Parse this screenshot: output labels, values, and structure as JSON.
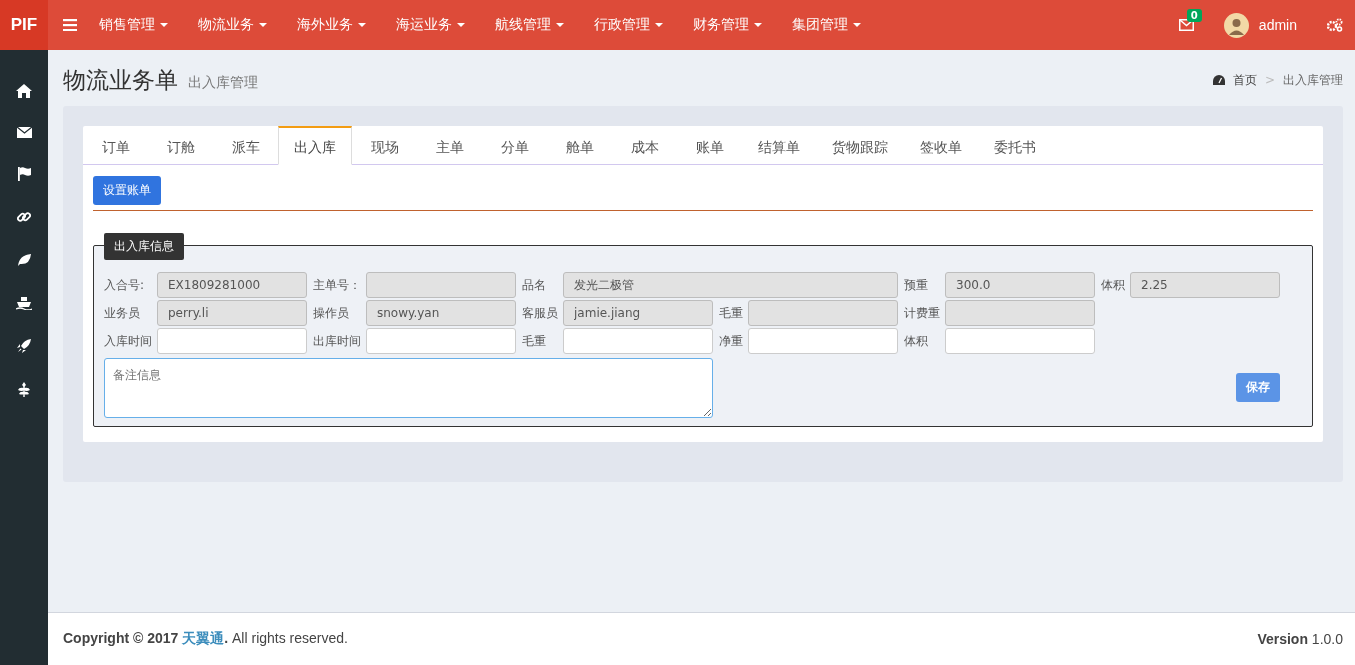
{
  "brand": "PIF",
  "nav": [
    {
      "label": "销售管理"
    },
    {
      "label": "物流业务"
    },
    {
      "label": "海外业务"
    },
    {
      "label": "海运业务"
    },
    {
      "label": "航线管理"
    },
    {
      "label": "行政管理"
    },
    {
      "label": "财务管理"
    },
    {
      "label": "集团管理"
    }
  ],
  "mail_badge": "0",
  "user": "admin",
  "page": {
    "title": "物流业务单",
    "subtitle": "出入库管理"
  },
  "breadcrumb": {
    "home": "首页",
    "separator": ">",
    "current": "出入库管理"
  },
  "tabs": [
    {
      "label": "订单",
      "selected": false
    },
    {
      "label": "订舱",
      "selected": false
    },
    {
      "label": "派车",
      "selected": false
    },
    {
      "label": "出入库",
      "selected": true
    },
    {
      "label": "现场",
      "selected": false
    },
    {
      "label": "主单",
      "selected": false
    },
    {
      "label": "分单",
      "selected": false
    },
    {
      "label": "舱单",
      "selected": false
    },
    {
      "label": "成本",
      "selected": false
    },
    {
      "label": "账单",
      "selected": false
    },
    {
      "label": "结算单",
      "selected": false
    },
    {
      "label": "货物跟踪",
      "selected": false
    },
    {
      "label": "签收单",
      "selected": false
    },
    {
      "label": "委托书",
      "selected": false
    }
  ],
  "set_bill_button": "设置账单",
  "fieldset": {
    "legend": "出入库信息",
    "fields": [
      {
        "label": "入合号:",
        "value": "EX1809281000",
        "readonly": true,
        "kind": "field"
      },
      {
        "label": "主单号：",
        "readonly": true,
        "kind": "field"
      },
      {
        "label": "品名",
        "value": "发光二极管",
        "readonly": true,
        "kind": "wide"
      },
      {
        "label": "预重",
        "value": "300.0",
        "readonly": true,
        "kind": "field"
      },
      {
        "label": "体积",
        "value": "2.25",
        "readonly": true,
        "kind": "field"
      },
      {
        "label": "业务员",
        "value": "perry.li",
        "readonly": true,
        "kind": "field"
      },
      {
        "label": "操作员",
        "value": "snowy.yan",
        "readonly": true,
        "kind": "field"
      },
      {
        "label": "客服员",
        "value": "jamie.jiang",
        "readonly": true,
        "kind": "field"
      },
      {
        "label": "毛重",
        "readonly": true,
        "kind": "field"
      },
      {
        "label": "计费重",
        "readonly": true,
        "kind": "row-end"
      },
      {
        "label": "入库时间",
        "readonly": false,
        "kind": "field"
      },
      {
        "label": "出库时间",
        "readonly": false,
        "kind": "field"
      },
      {
        "label": "毛重",
        "readonly": false,
        "kind": "field"
      },
      {
        "label": "净重",
        "readonly": false,
        "kind": "field"
      },
      {
        "label": "体积",
        "readonly": false,
        "kind": "row-end"
      }
    ],
    "remarks": {
      "placeholder": "备注信息"
    },
    "save_button": "保存"
  },
  "footer": {
    "copyright": "**Copyright © 2017** ",
    "link": "天翼通",
    "after_link": "**.** All rights reserved.",
    "version": "**Version** 1.0.0"
  }
}
